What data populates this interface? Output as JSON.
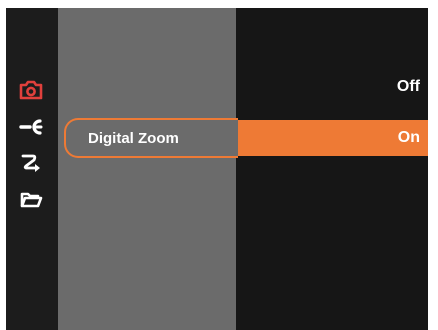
{
  "menu": {
    "items": [
      {
        "label": "Digital Zoom"
      }
    ]
  },
  "values": {
    "options": [
      {
        "label": "Off",
        "selected": false
      },
      {
        "label": "On",
        "selected": true
      }
    ]
  },
  "sidebar": {
    "icons": [
      {
        "name": "camera-icon",
        "active": true
      },
      {
        "name": "wrench-icon",
        "active": false
      },
      {
        "name": "transfer-arrow-icon",
        "active": false
      },
      {
        "name": "folder-icon",
        "active": false
      }
    ]
  },
  "colors": {
    "accent": "#ee7a35",
    "active_icon": "#e0403c",
    "menu_panel": "#6b6b6b",
    "background": "#161616"
  }
}
